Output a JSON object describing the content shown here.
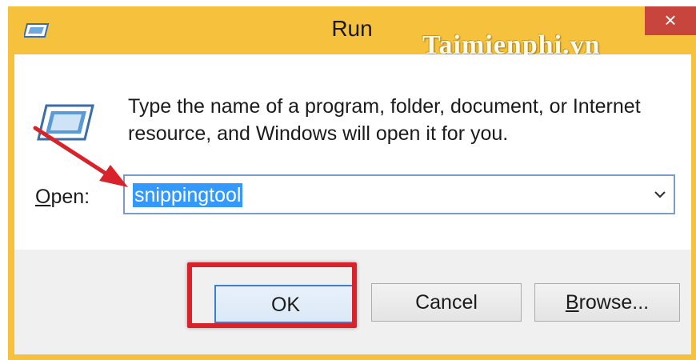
{
  "window": {
    "title": "Run",
    "watermark": "Taimienphi.vn",
    "close_glyph": "×",
    "icons": {
      "title": "run-app-icon",
      "close": "close-icon"
    },
    "colors": {
      "frame": "#f6c23d",
      "close": "#c7453d",
      "annotation": "#d8232a",
      "selection": "#3399ff"
    }
  },
  "body": {
    "description_line1": "Type the name of a program, folder, document, or Internet",
    "description_line2": "resource, and Windows will open it for you.",
    "open_label_mnemonic": "O",
    "open_label_rest": "pen:",
    "open_value": "snippingtool"
  },
  "buttons": {
    "ok": "OK",
    "cancel": "Cancel",
    "browse_mnemonic": "B",
    "browse_rest": "rowse..."
  }
}
